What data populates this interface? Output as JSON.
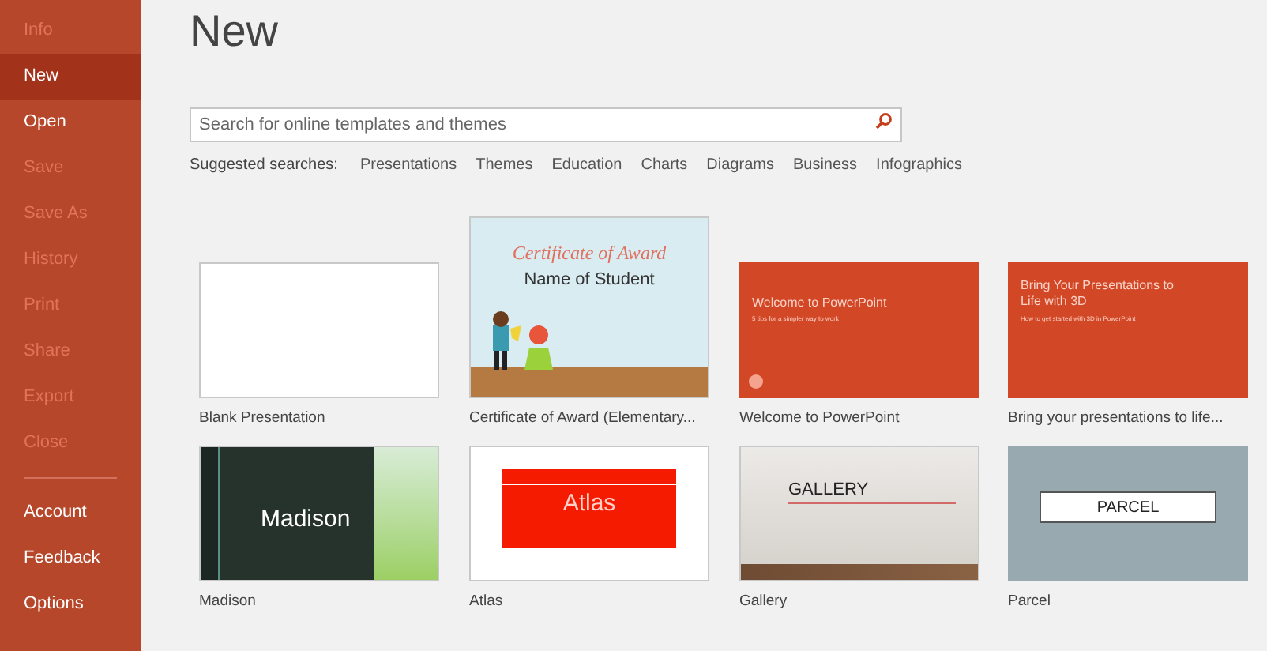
{
  "sidebar": {
    "items": [
      {
        "label": "Info",
        "selected": false,
        "disabled": true
      },
      {
        "label": "New",
        "selected": true,
        "disabled": false
      },
      {
        "label": "Open",
        "selected": false,
        "disabled": false
      },
      {
        "label": "Save",
        "selected": false,
        "disabled": true
      },
      {
        "label": "Save As",
        "selected": false,
        "disabled": true
      },
      {
        "label": "History",
        "selected": false,
        "disabled": true
      },
      {
        "label": "Print",
        "selected": false,
        "disabled": true
      },
      {
        "label": "Share",
        "selected": false,
        "disabled": true
      },
      {
        "label": "Export",
        "selected": false,
        "disabled": true
      },
      {
        "label": "Close",
        "selected": false,
        "disabled": true
      }
    ],
    "footer_items": [
      {
        "label": "Account",
        "selected": false,
        "disabled": false
      },
      {
        "label": "Feedback",
        "selected": false,
        "disabled": false
      },
      {
        "label": "Options",
        "selected": false,
        "disabled": false
      }
    ]
  },
  "title": "New",
  "search": {
    "placeholder": "Search for online templates and themes"
  },
  "suggested": {
    "label": "Suggested searches:",
    "links": [
      "Presentations",
      "Themes",
      "Education",
      "Charts",
      "Diagrams",
      "Business",
      "Infographics"
    ]
  },
  "templates": [
    {
      "kind": "blank",
      "name": "Blank Presentation"
    },
    {
      "kind": "certificate",
      "name": "Certificate of Award (Elementary...",
      "slide_title": "Certificate of Award",
      "slide_text": "Name of Student"
    },
    {
      "kind": "welcome",
      "name": "Welcome to PowerPoint",
      "slide_title": "Welcome to PowerPoint",
      "slide_text": "5 tips for a simpler way to work"
    },
    {
      "kind": "bring3d",
      "name": "Bring your presentations to life...",
      "slide_title": "Bring Your Presentations to Life with 3D",
      "slide_text": "How to get started with 3D in PowerPoint"
    },
    {
      "kind": "madison",
      "name": "Madison",
      "slide_title": "Madison"
    },
    {
      "kind": "atlas",
      "name": "Atlas",
      "slide_title": "Atlas"
    },
    {
      "kind": "gallery",
      "name": "Gallery",
      "slide_title": "GALLERY"
    },
    {
      "kind": "parcel",
      "name": "Parcel",
      "slide_title": "PARCEL"
    }
  ]
}
